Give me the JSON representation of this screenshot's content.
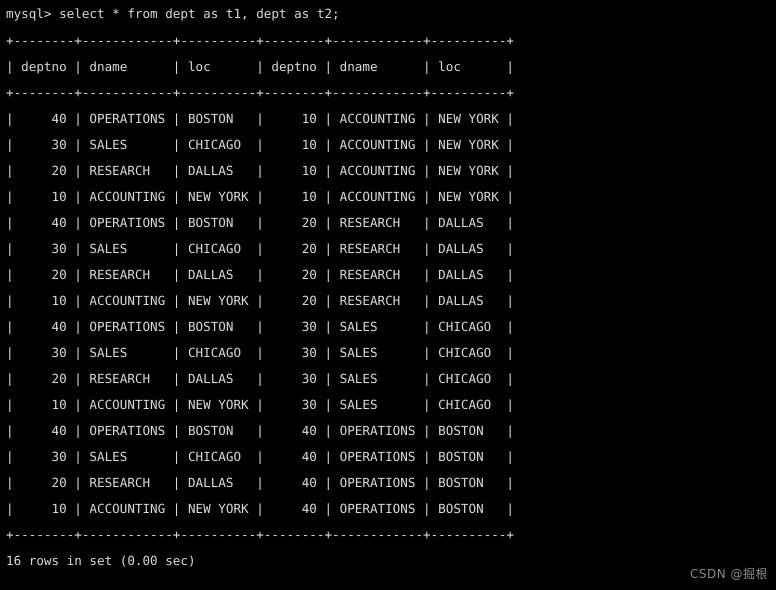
{
  "terminal": {
    "prompt": "mysql>",
    "command": " select * from dept as t1, dept as t2;",
    "prompt_line": "mysql> select * from dept as t1, dept as t2;",
    "background_color": "#000000",
    "text_color": "#d8d8d8",
    "status_line": "16 rows in set (0.00 sec)",
    "row_count": 16,
    "elapsed": "0.00 sec"
  },
  "table": {
    "separator": "+--------+------------+----------+--------+------------+----------+",
    "header_line": "| deptno | dname      | loc      | deptno | dname      | loc      |",
    "columns": [
      {
        "name": "deptno",
        "width": 6,
        "align": "right"
      },
      {
        "name": "dname",
        "width": 10,
        "align": "left"
      },
      {
        "name": "loc",
        "width": 8,
        "align": "left"
      },
      {
        "name": "deptno",
        "width": 6,
        "align": "right"
      },
      {
        "name": "dname",
        "width": 10,
        "align": "left"
      },
      {
        "name": "loc",
        "width": 8,
        "align": "left"
      }
    ],
    "headers": [
      "deptno",
      "dname",
      "loc",
      "deptno",
      "dname",
      "loc"
    ],
    "rows": [
      [
        "40",
        "OPERATIONS",
        "BOSTON",
        "10",
        "ACCOUNTING",
        "NEW YORK"
      ],
      [
        "30",
        "SALES",
        "CHICAGO",
        "10",
        "ACCOUNTING",
        "NEW YORK"
      ],
      [
        "20",
        "RESEARCH",
        "DALLAS",
        "10",
        "ACCOUNTING",
        "NEW YORK"
      ],
      [
        "10",
        "ACCOUNTING",
        "NEW YORK",
        "10",
        "ACCOUNTING",
        "NEW YORK"
      ],
      [
        "40",
        "OPERATIONS",
        "BOSTON",
        "20",
        "RESEARCH",
        "DALLAS"
      ],
      [
        "30",
        "SALES",
        "CHICAGO",
        "20",
        "RESEARCH",
        "DALLAS"
      ],
      [
        "20",
        "RESEARCH",
        "DALLAS",
        "20",
        "RESEARCH",
        "DALLAS"
      ],
      [
        "10",
        "ACCOUNTING",
        "NEW YORK",
        "20",
        "RESEARCH",
        "DALLAS"
      ],
      [
        "40",
        "OPERATIONS",
        "BOSTON",
        "30",
        "SALES",
        "CHICAGO"
      ],
      [
        "30",
        "SALES",
        "CHICAGO",
        "30",
        "SALES",
        "CHICAGO"
      ],
      [
        "20",
        "RESEARCH",
        "DALLAS",
        "30",
        "SALES",
        "CHICAGO"
      ],
      [
        "10",
        "ACCOUNTING",
        "NEW YORK",
        "30",
        "SALES",
        "CHICAGO"
      ],
      [
        "40",
        "OPERATIONS",
        "BOSTON",
        "40",
        "OPERATIONS",
        "BOSTON"
      ],
      [
        "30",
        "SALES",
        "CHICAGO",
        "40",
        "OPERATIONS",
        "BOSTON"
      ],
      [
        "20",
        "RESEARCH",
        "DALLAS",
        "40",
        "OPERATIONS",
        "BOSTON"
      ],
      [
        "10",
        "ACCOUNTING",
        "NEW YORK",
        "40",
        "OPERATIONS",
        "BOSTON"
      ]
    ]
  },
  "watermark": {
    "text": "CSDN @掘根",
    "color": "#8a8a8a"
  }
}
